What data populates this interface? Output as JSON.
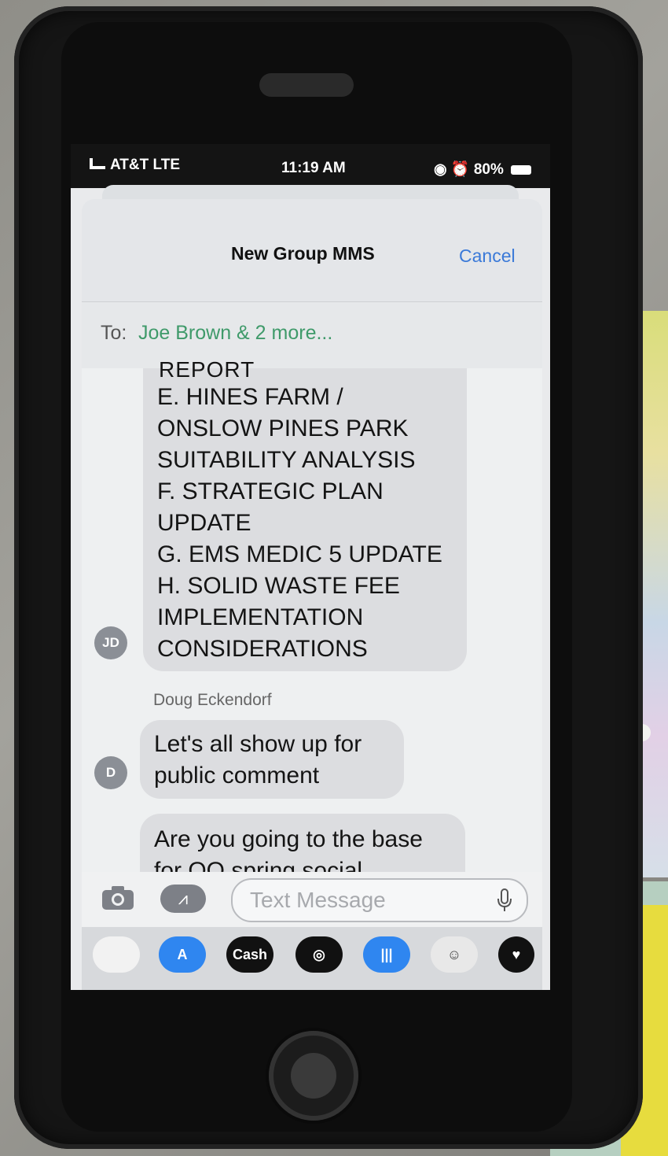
{
  "status_bar": {
    "carrier": "AT&T  LTE",
    "time": "11:19 AM",
    "battery": "80%"
  },
  "header": {
    "title": "New Group MMS",
    "cancel_label": "Cancel"
  },
  "recipients": {
    "to_label": "To:",
    "value": "Joe  Brown  & 2 more..."
  },
  "messages": [
    {
      "avatar": "JD",
      "partial_top_line": "REPORT",
      "lines": [
        "E. HINES FARM /",
        "ONSLOW PINES PARK",
        "SUITABILITY ANALYSIS",
        "F. STRATEGIC PLAN",
        "UPDATE",
        "G. EMS MEDIC 5 UPDATE",
        "H. SOLID WASTE FEE",
        "IMPLEMENTATION",
        "CONSIDERATIONS"
      ]
    },
    {
      "sender": "Doug Eckendorf",
      "avatar": "D",
      "lines": [
        "Let's all show up for",
        "public comment"
      ]
    },
    {
      "lines": [
        "Are you going to the base",
        "for OO spring social"
      ]
    }
  ],
  "compose": {
    "placeholder": "Text Message"
  },
  "app_drawer": [
    {
      "name": "photos-app-icon",
      "label": "",
      "color": "#f2f2f2"
    },
    {
      "name": "app-store-icon",
      "label": "A",
      "color": "#2f86f0"
    },
    {
      "name": "apple-cash-icon",
      "label": "Cash",
      "color": "#111111"
    },
    {
      "name": "activity-icon",
      "label": "◎",
      "color": "#111111"
    },
    {
      "name": "audio-message-icon",
      "label": "|||",
      "color": "#2f86f0"
    },
    {
      "name": "memoji-icon",
      "label": "☺",
      "color": "#e8e8e8"
    },
    {
      "name": "digital-touch-icon",
      "label": "♥",
      "color": "#111111"
    }
  ]
}
